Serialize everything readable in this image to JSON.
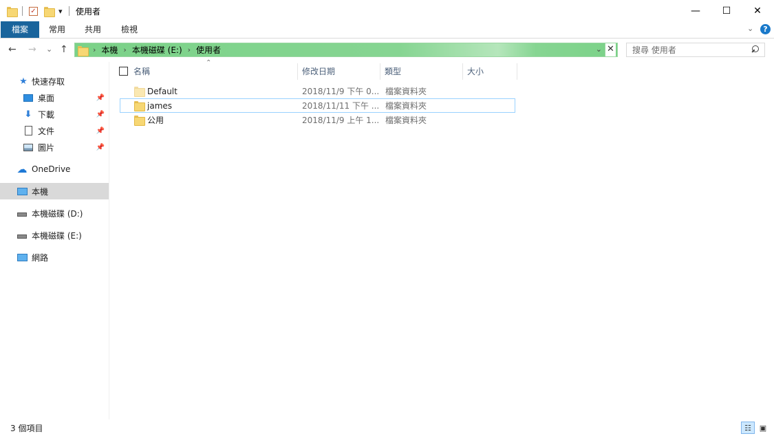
{
  "window": {
    "title": "使用者",
    "min_glyph": "—",
    "max_glyph": "☐",
    "close_glyph": "✕"
  },
  "quick_access_toolbar": {
    "dropdown_glyph": "▾",
    "checkmark_glyph": "✓"
  },
  "ribbon": {
    "tabs": [
      {
        "label": "檔案"
      },
      {
        "label": "常用"
      },
      {
        "label": "共用"
      },
      {
        "label": "檢視"
      }
    ],
    "expand_glyph": "⌄",
    "help_glyph": "?"
  },
  "nav": {
    "back_glyph": "←",
    "forward_glyph": "→",
    "recent_glyph": "⌄",
    "up_glyph": "↑"
  },
  "address_bar": {
    "crumb_sep": "›",
    "crumbs": [
      "本機",
      "本機磁碟 (E:)",
      "使用者"
    ],
    "dropdown_glyph": "⌄",
    "clear_glyph": "✕"
  },
  "search": {
    "placeholder": "搜尋 使用者"
  },
  "sidebar": {
    "pin_glyph": "📌",
    "items": [
      {
        "label": "快速存取",
        "icon": "star-icon"
      },
      {
        "label": "桌面",
        "icon": "desktop-icon",
        "pinned": true
      },
      {
        "label": "下載",
        "icon": "download-icon",
        "pinned": true
      },
      {
        "label": "文件",
        "icon": "document-icon",
        "pinned": true
      },
      {
        "label": "圖片",
        "icon": "pictures-icon",
        "pinned": true
      },
      {
        "label": "OneDrive",
        "icon": "cloud-icon"
      },
      {
        "label": "本機",
        "icon": "computer-icon",
        "selected": true
      },
      {
        "label": "本機磁碟 (D:)",
        "icon": "drive-icon"
      },
      {
        "label": "本機磁碟 (E:)",
        "icon": "drive-icon"
      },
      {
        "label": "網路",
        "icon": "network-icon"
      }
    ]
  },
  "columns": {
    "sort_caret": "⌃",
    "name": "名稱",
    "date_modified": "修改日期",
    "type": "類型",
    "size": "大小"
  },
  "files": [
    {
      "name": "Default",
      "date": "2018/11/9 下午 0...",
      "type": "檔案資料夾",
      "size": ""
    },
    {
      "name": "james",
      "date": "2018/11/11 下午 ...",
      "type": "檔案資料夾",
      "size": "",
      "focused": true
    },
    {
      "name": "公用",
      "date": "2018/11/9 上午 1...",
      "type": "檔案資料夾",
      "size": ""
    }
  ],
  "status_bar": {
    "item_count": "3 個項目",
    "details_view_glyph": "☷",
    "large_icons_view_glyph": "▣"
  },
  "colors": {
    "file_tab": "#19649c",
    "address_progress": "#7bd288",
    "selected_nav": "#d9d9d9",
    "focus_border": "#99d1ff"
  }
}
